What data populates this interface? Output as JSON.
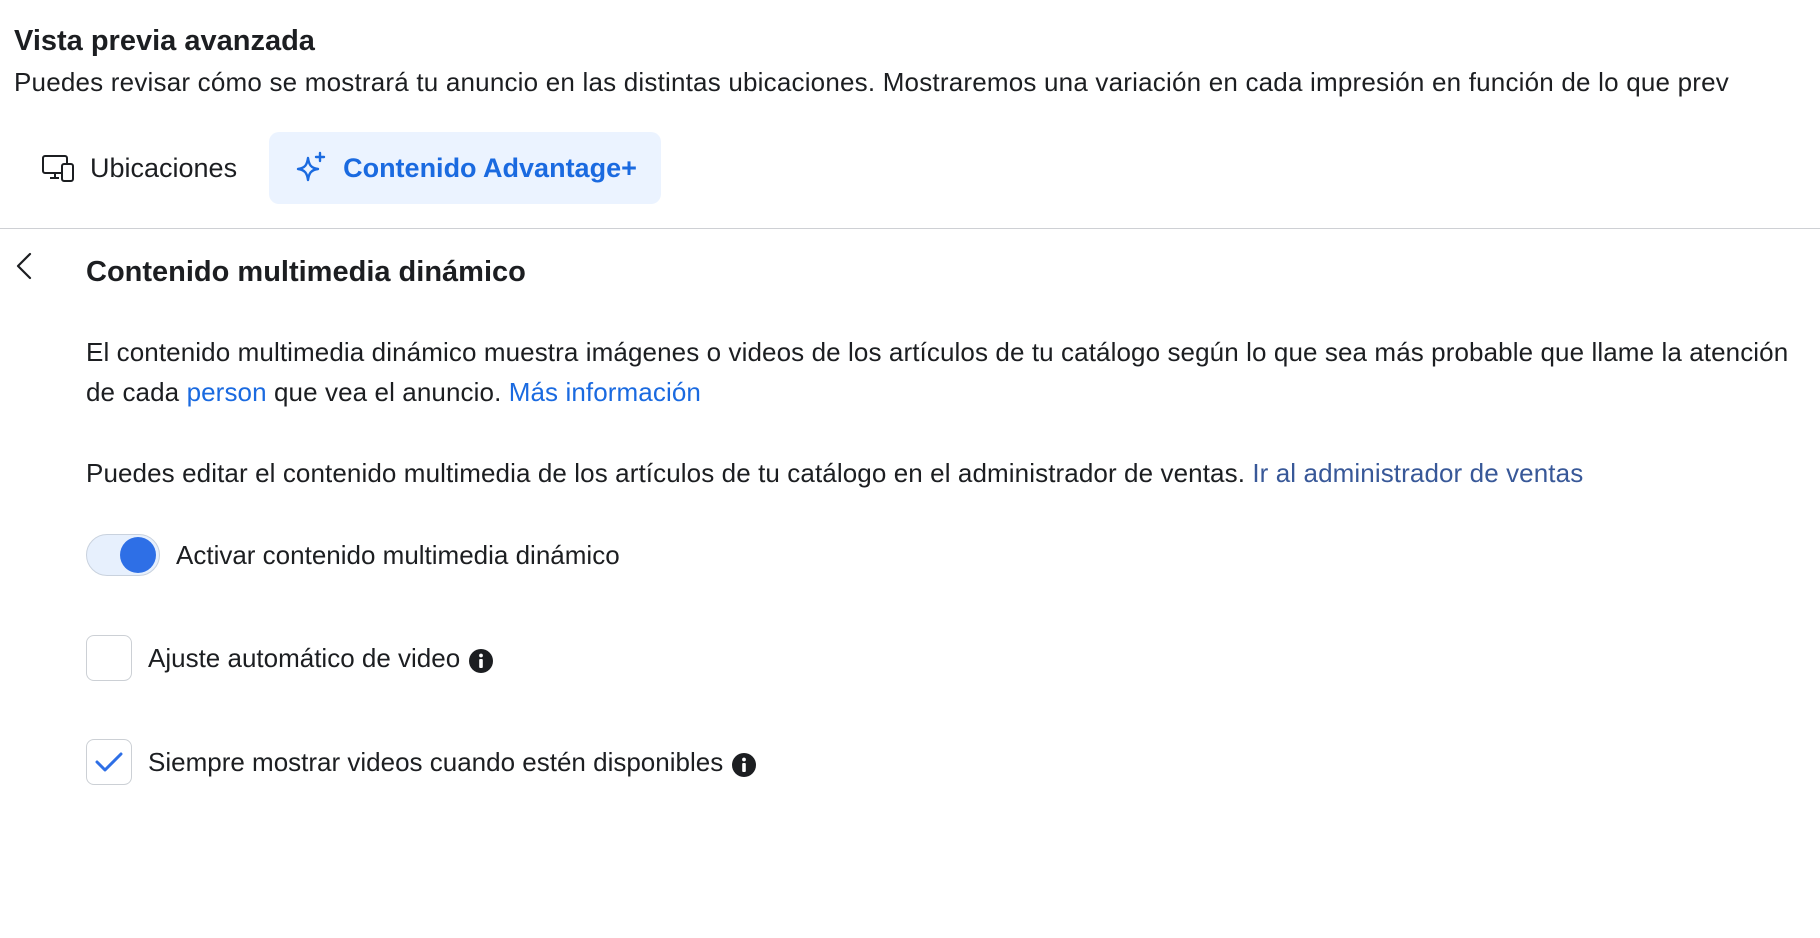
{
  "header": {
    "title": "Vista previa avanzada",
    "subtitle": "Puedes revisar cómo se mostrará tu anuncio en las distintas ubicaciones. Mostraremos una variación en cada impresión en función de lo que prev"
  },
  "tabs": [
    {
      "label": "Ubicaciones",
      "icon": "devices-icon",
      "active": false
    },
    {
      "label": "Contenido Advantage+",
      "icon": "sparkle-icon",
      "active": true
    }
  ],
  "section": {
    "title": "Contenido multimedia dinámico",
    "para1_part1": "El contenido multimedia dinámico muestra imágenes o videos de los artículos de tu catálogo según lo que sea más probable que llame la atención de cada ",
    "para1_link1": "person",
    "para1_part2": " que vea el anuncio. ",
    "para1_link2": "Más información",
    "para2_text": "Puedes editar el contenido multimedia de los artículos de tu catálogo en el administrador de ventas. ",
    "para2_link": "Ir al administrador de ventas"
  },
  "toggle": {
    "label": "Activar contenido multimedia dinámico",
    "checked": true
  },
  "checkboxes": [
    {
      "label": "Ajuste automático de video",
      "checked": false
    },
    {
      "label": "Siempre mostrar videos cuando estén disponibles",
      "checked": true
    }
  ],
  "colors": {
    "accent": "#1a6ae0",
    "toggle_knob": "#2e6fe6",
    "tab_active_bg": "#ebf3ff",
    "link_dark": "#385898"
  }
}
